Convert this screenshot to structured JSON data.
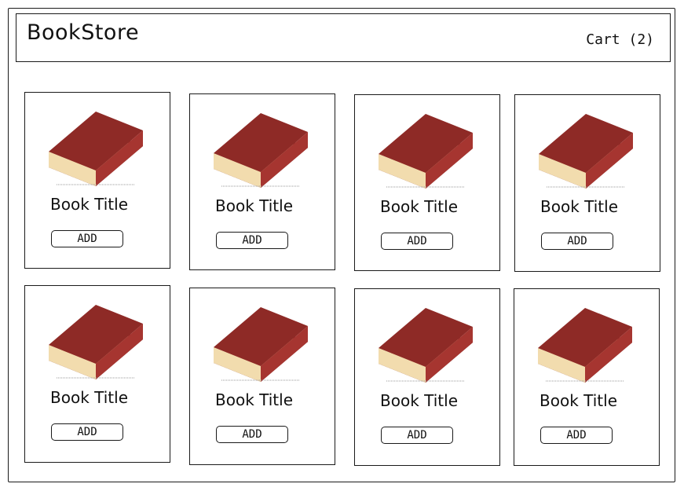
{
  "header": {
    "brand": "BookStore",
    "cart_label": "Cart (2)"
  },
  "books": [
    {
      "title": "Book Title",
      "add_label": "ADD"
    },
    {
      "title": "Book Title",
      "add_label": "ADD"
    },
    {
      "title": "Book Title",
      "add_label": "ADD"
    },
    {
      "title": "Book Title",
      "add_label": "ADD"
    },
    {
      "title": "Book Title",
      "add_label": "ADD"
    },
    {
      "title": "Book Title",
      "add_label": "ADD"
    },
    {
      "title": "Book Title",
      "add_label": "ADD"
    },
    {
      "title": "Book Title",
      "add_label": "ADD"
    }
  ],
  "icons": {
    "book": "book-cover-image"
  },
  "colors": {
    "book_cover": "#8e2a26",
    "book_pages": "#f2dcae",
    "outline": "#1a1a1a"
  }
}
